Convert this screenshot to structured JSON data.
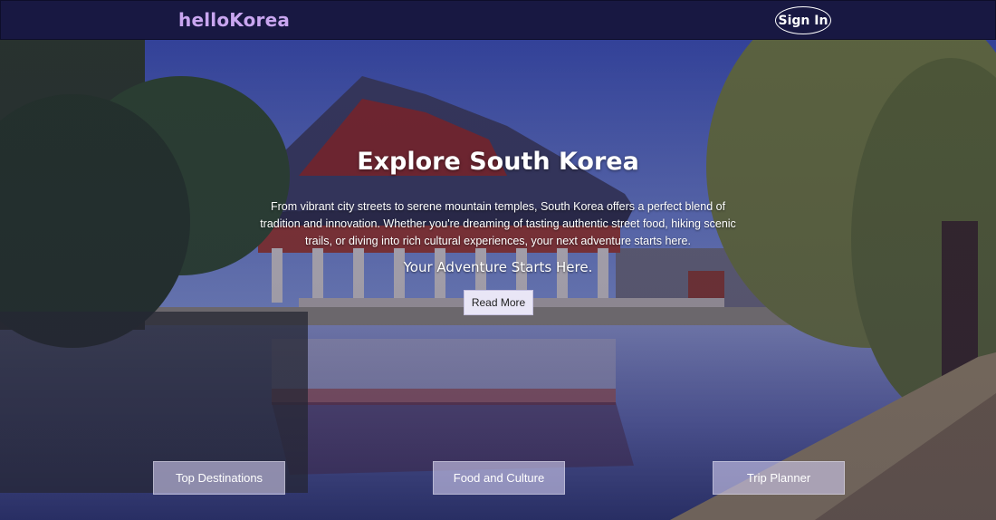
{
  "navbar": {
    "brand": "helloKorea",
    "signin_label": "Sign In"
  },
  "hero": {
    "title": "Explore South Korea",
    "description": "From vibrant city streets to serene mountain temples, South Korea offers a perfect blend of tradition and innovation. Whether you're dreaming of tasting authentic street food, hiking scenic trails, or diving into rich cultural experiences, your next adventure starts here.",
    "tagline": "Your Adventure Starts Here.",
    "read_more_label": "Read More"
  },
  "quick_links": [
    {
      "label": "Top Destinations"
    },
    {
      "label": "Food and Culture"
    },
    {
      "label": "Trip Planner"
    }
  ],
  "colors": {
    "navbar_bg": "#181842",
    "brand_text": "#c9a6f0",
    "overlay": "#2a2466"
  }
}
